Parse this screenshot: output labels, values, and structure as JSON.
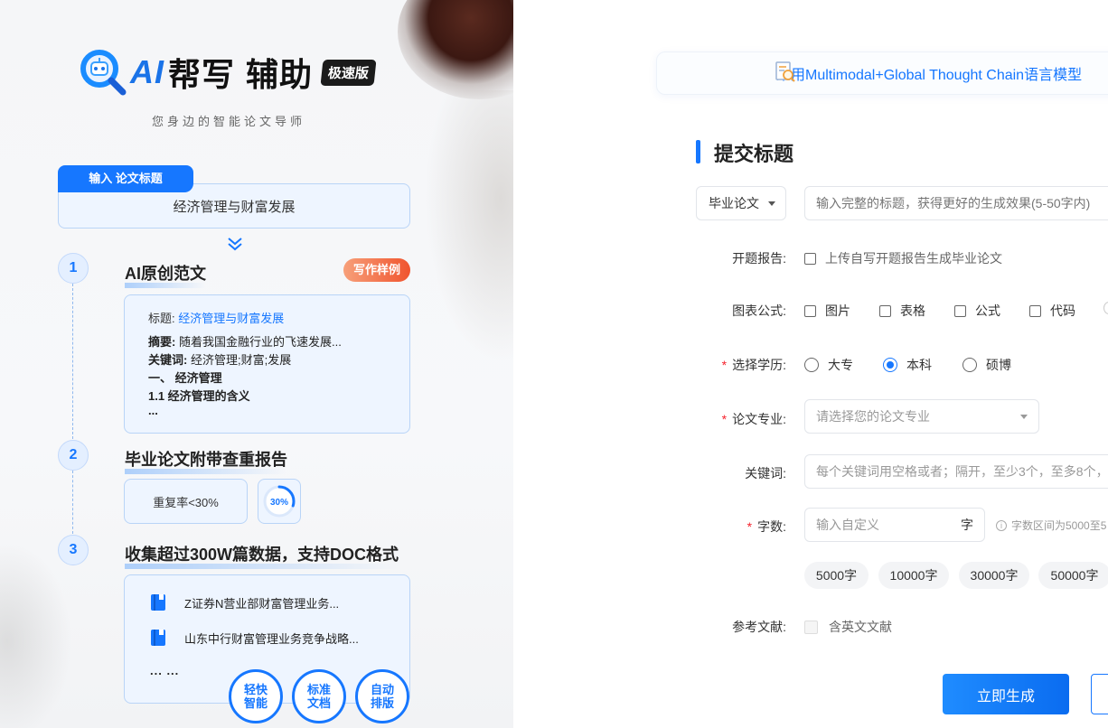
{
  "brand": {
    "ai": "AI",
    "name_part1": "帮写",
    "name_part2": "辅助",
    "badge": "极速版",
    "slogan": "您身边的智能论文导师"
  },
  "input_title": {
    "tag": "输入 论文标题",
    "value": "经济管理与财富发展"
  },
  "steps": [
    {
      "num": "1",
      "title": "AI原创范文",
      "badge": "写作样例"
    },
    {
      "num": "2",
      "title": "毕业论文附带查重报告"
    },
    {
      "num": "3",
      "title": "收集超过300W篇数据，支持DOC格式"
    }
  ],
  "sample": {
    "title_label": "标题:",
    "title_value": "经济管理与财富发展",
    "abstract_label": "摘要:",
    "abstract_value": "随着我国金融行业的飞速发展...",
    "keywords_label": "关键词:",
    "keywords_value": "经济管理;财富;发展",
    "line1": "一、 经济管理",
    "line2": "1.1 经济管理的含义",
    "ellipsis": "..."
  },
  "report": {
    "rate_text": "重复率<30%",
    "ring_label": "30%",
    "ring_value": 0.3
  },
  "database": {
    "items": [
      "Z证券N营业部财富管理业务...",
      "山东中行财富管理业务竞争战略..."
    ],
    "more": "... ..."
  },
  "features": [
    {
      "line1": "轻快",
      "line2": "智能"
    },
    {
      "line1": "标准",
      "line2": "文档"
    },
    {
      "line1": "自动",
      "line2": "排版"
    }
  ],
  "notice": {
    "text": "采用Multimodal+Global Thought Chain语言模型"
  },
  "form": {
    "section_title": "提交标题",
    "type_select": "毕业论文",
    "title_placeholder": "输入完整的标题，获得更好的生成效果(5-50字内)",
    "proposal_label": "开题报告:",
    "proposal_option": "上传自写开题报告生成毕业论文",
    "charts_label": "图表公式:",
    "charts_options": [
      "图片",
      "表格",
      "公式",
      "代码"
    ],
    "degree_label": "选择学历:",
    "degree_options": [
      "大专",
      "本科",
      "硕博"
    ],
    "degree_selected": "本科",
    "major_label": "论文专业:",
    "major_placeholder": "请选择您的论文专业",
    "keywords_label": "关键词:",
    "keywords_placeholder": "每个关键词用空格或者；隔开，至少3个，至多8个，",
    "wordcount_label": "字数:",
    "wordcount_placeholder": "输入自定义",
    "wordcount_unit": "字",
    "wordcount_hint": "字数区间为5000至5",
    "wordcount_chips": [
      "5000字",
      "10000字",
      "30000字",
      "50000字"
    ],
    "refs_label": "参考文献:",
    "refs_option": "含英文文献",
    "generate_button": "立即生成"
  },
  "colors": {
    "accent": "#1677ff",
    "badge_gradient_start": "#f7a07a",
    "badge_gradient_end": "#f0542e",
    "required": "#f5222d"
  }
}
